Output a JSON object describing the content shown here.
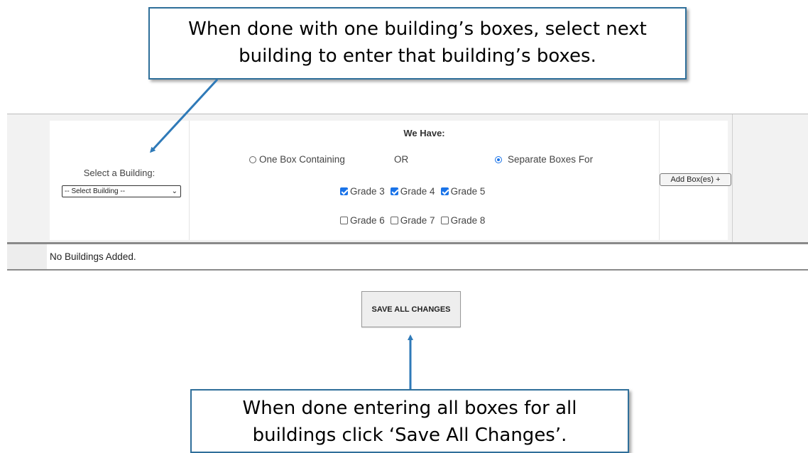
{
  "callouts": {
    "top": {
      "line1": "When done with one building’s boxes, select next",
      "line2": "building to enter that building’s boxes."
    },
    "bottom": {
      "line1": "When done entering all boxes for all",
      "line2": "buildings click ‘Save All Changes’."
    }
  },
  "form": {
    "building_label": "Select a Building:",
    "building_select": "-- Select Building --",
    "we_have": "We Have:",
    "option_one_box": "One Box Containing",
    "or_text": "OR",
    "option_separate": "Separate Boxes For",
    "selected_option": "Separate Boxes For",
    "grades": [
      {
        "label": "Grade 3",
        "checked": true
      },
      {
        "label": "Grade 4",
        "checked": true
      },
      {
        "label": "Grade 5",
        "checked": true
      },
      {
        "label": "Grade 6",
        "checked": false
      },
      {
        "label": "Grade 7",
        "checked": false
      },
      {
        "label": "Grade 8",
        "checked": false
      }
    ],
    "add_button": "Add Box(es) +"
  },
  "status": "No Buildings Added.",
  "save_button": "SAVE ALL CHANGES",
  "colors": {
    "callout_border": "#2f6f9a",
    "arrow": "#2f7ab8",
    "check_accent": "#1a73e8"
  }
}
